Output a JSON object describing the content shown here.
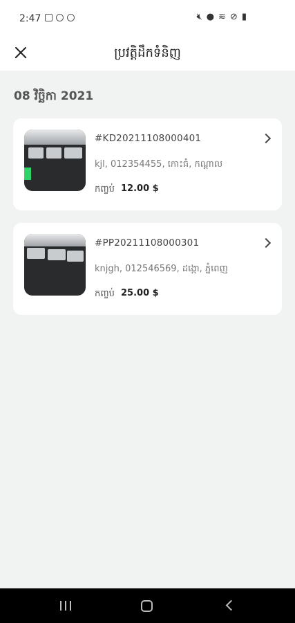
{
  "status_bar": {
    "time": "2:47",
    "left_icons": [
      "gallery-icon",
      "sync-icon",
      "sync-icon"
    ],
    "right_icons": [
      "mute-icon",
      "location-icon",
      "wifi-icon",
      "dnd-icon",
      "battery-icon"
    ]
  },
  "header": {
    "close_icon": "close-icon",
    "title": "ប្រវត្តិដឹកទំនិញ"
  },
  "date_group": "08 វិច្ឆិកា 2021",
  "orders": [
    {
      "id": "#KD20211108000401",
      "customer": "kjl, 012354455, កោះធំ, កណ្តាល",
      "total_label": "កញ្ចប់",
      "total_value": "12.00 $"
    },
    {
      "id": "#PP20211108000301",
      "customer": "knjgh, 012546569, ដង្កោ, ភ្នំពេញ",
      "total_label": "កញ្ចប់",
      "total_value": "25.00 $"
    }
  ],
  "colors": {
    "background": "#f1f2f2",
    "card": "#ffffff",
    "text_primary": "#222222",
    "nav_bar": "#000000"
  }
}
